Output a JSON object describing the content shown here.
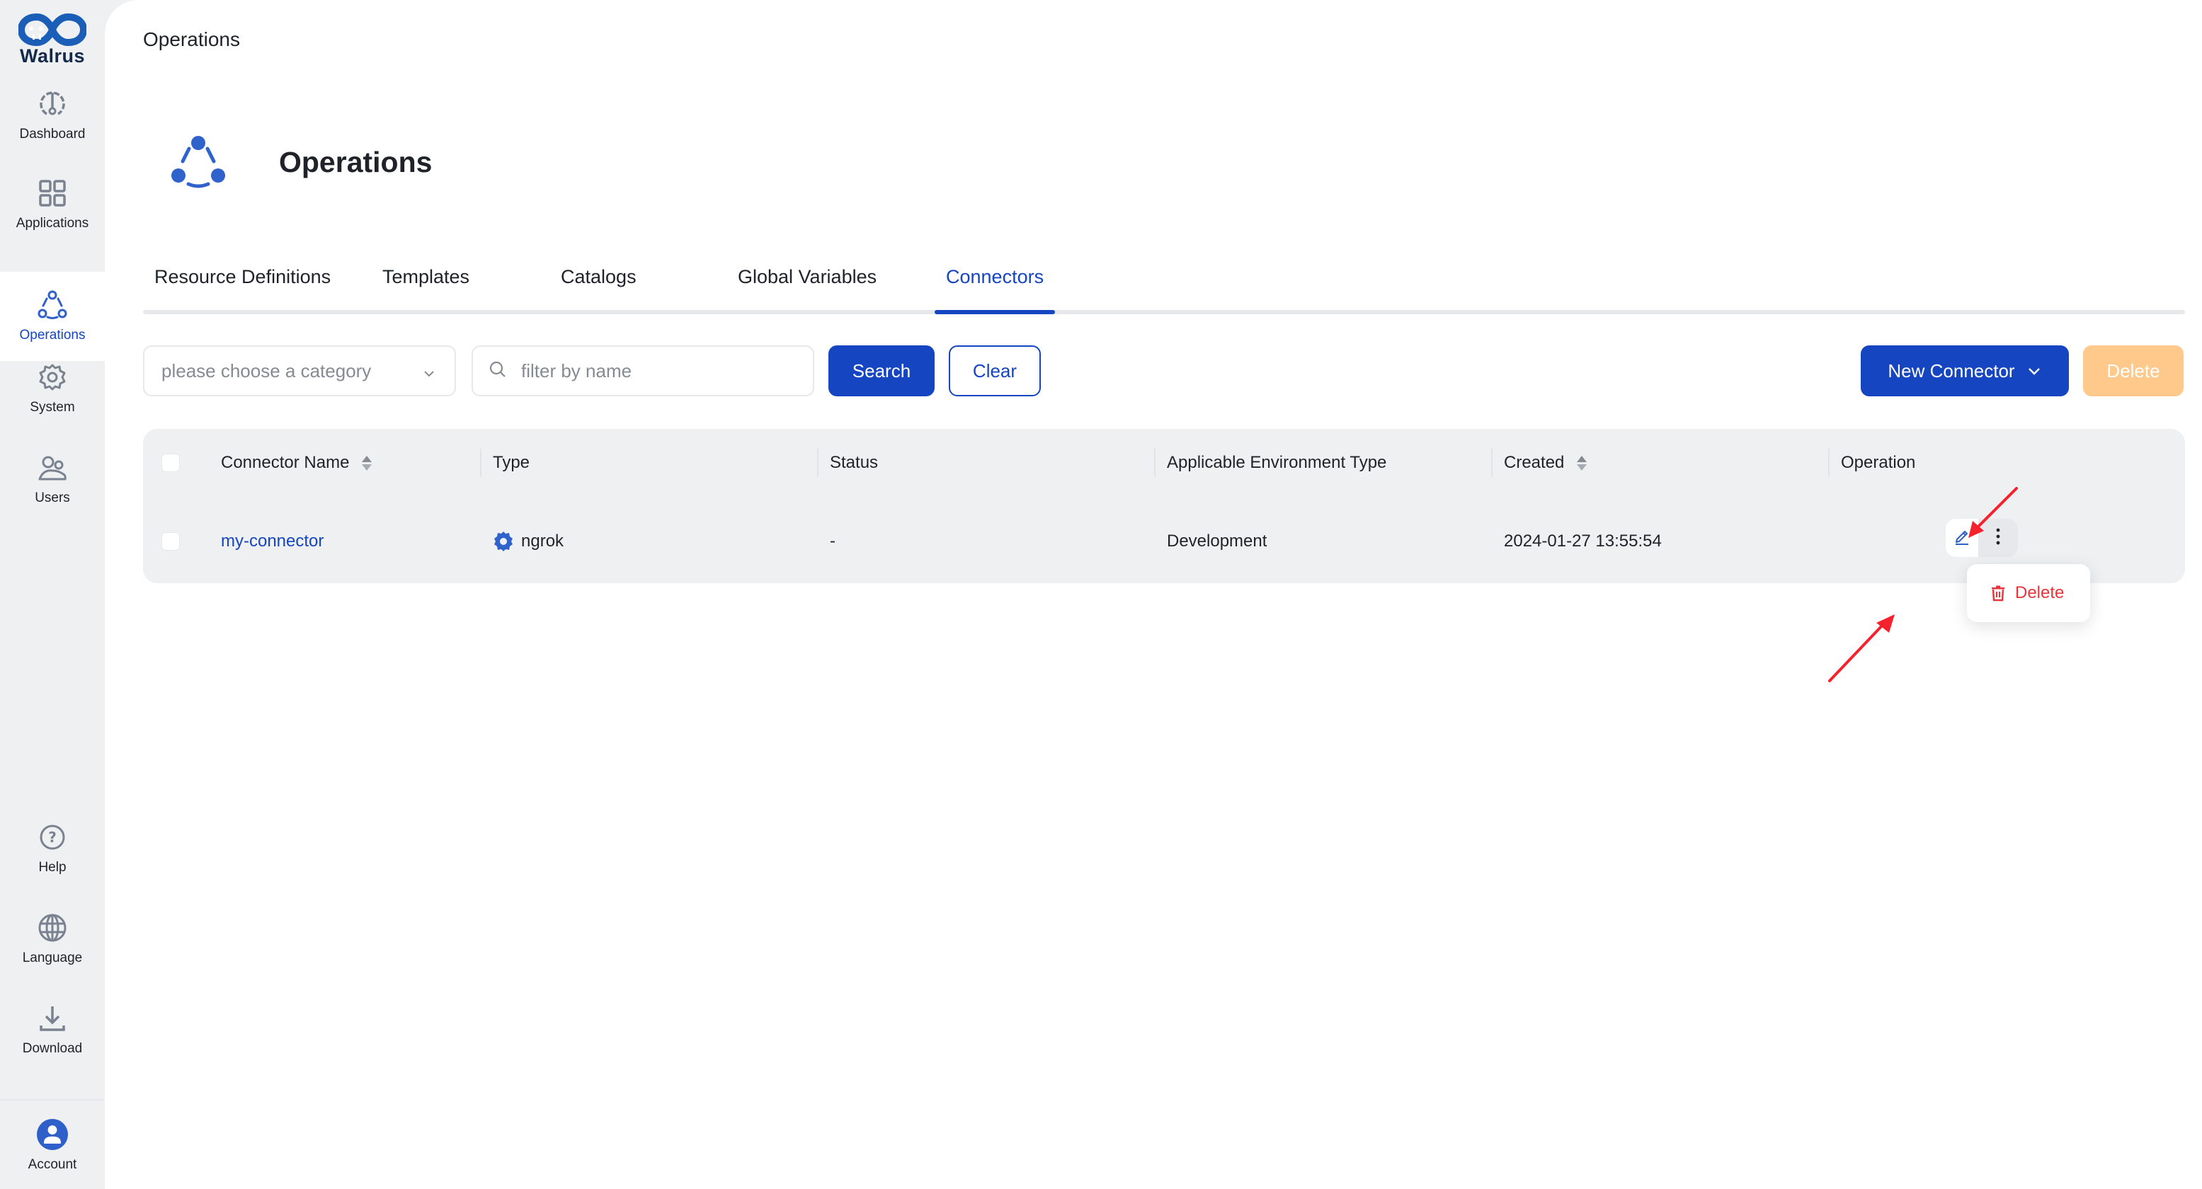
{
  "brand": {
    "name": "Walrus"
  },
  "sidebar": {
    "items": [
      {
        "id": "dashboard",
        "label": "Dashboard",
        "icon": "dashboard-gauge-icon",
        "active": false
      },
      {
        "id": "applications",
        "label": "Applications",
        "icon": "grid-icon",
        "active": false
      },
      {
        "id": "operations",
        "label": "Operations",
        "icon": "operations-icon",
        "active": true
      },
      {
        "id": "system",
        "label": "System",
        "icon": "gear-icon",
        "active": false
      },
      {
        "id": "users",
        "label": "Users",
        "icon": "users-icon",
        "active": false
      }
    ],
    "bottom_items": [
      {
        "id": "help",
        "label": "Help",
        "icon": "help-icon"
      },
      {
        "id": "language",
        "label": "Language",
        "icon": "globe-icon"
      },
      {
        "id": "download",
        "label": "Download",
        "icon": "download-icon"
      }
    ],
    "account": {
      "label": "Account",
      "icon": "account-avatar-icon"
    }
  },
  "breadcrumb": "Operations",
  "page": {
    "title": "Operations",
    "icon": "operations-icon"
  },
  "tabs": [
    {
      "label": "Resource Definitions",
      "active": false
    },
    {
      "label": "Templates",
      "active": false
    },
    {
      "label": "Catalogs",
      "active": false
    },
    {
      "label": "Global Variables",
      "active": false
    },
    {
      "label": "Connectors",
      "active": true
    }
  ],
  "filters": {
    "category": {
      "placeholder": "please choose a category",
      "value": ""
    },
    "name": {
      "placeholder": "filter by name",
      "value": ""
    },
    "search_label": "Search",
    "clear_label": "Clear"
  },
  "toolbar": {
    "new_label": "New Connector",
    "delete_label": "Delete",
    "delete_disabled": true
  },
  "table": {
    "columns": [
      {
        "label": "Connector Name",
        "sortable": true
      },
      {
        "label": "Type",
        "sortable": false
      },
      {
        "label": "Status",
        "sortable": false
      },
      {
        "label": "Applicable Environment Type",
        "sortable": false
      },
      {
        "label": "Created",
        "sortable": true
      },
      {
        "label": "Operation",
        "sortable": false
      }
    ],
    "rows": [
      {
        "name": "my-connector",
        "type": "ngrok",
        "type_icon": "gear-icon",
        "status": "-",
        "environment_type": "Development",
        "created": "2024-01-27 13:55:54"
      }
    ]
  },
  "row_menu": {
    "open": true,
    "items": [
      {
        "label": "Delete",
        "icon": "trash-icon",
        "danger": true
      }
    ]
  },
  "colors": {
    "primary": "#1545c0",
    "danger": "#e8343a",
    "disabled_warning": "#fec98a",
    "sidebar_bg": "#eff0f2",
    "annotation_arrow": "#f5222d"
  }
}
